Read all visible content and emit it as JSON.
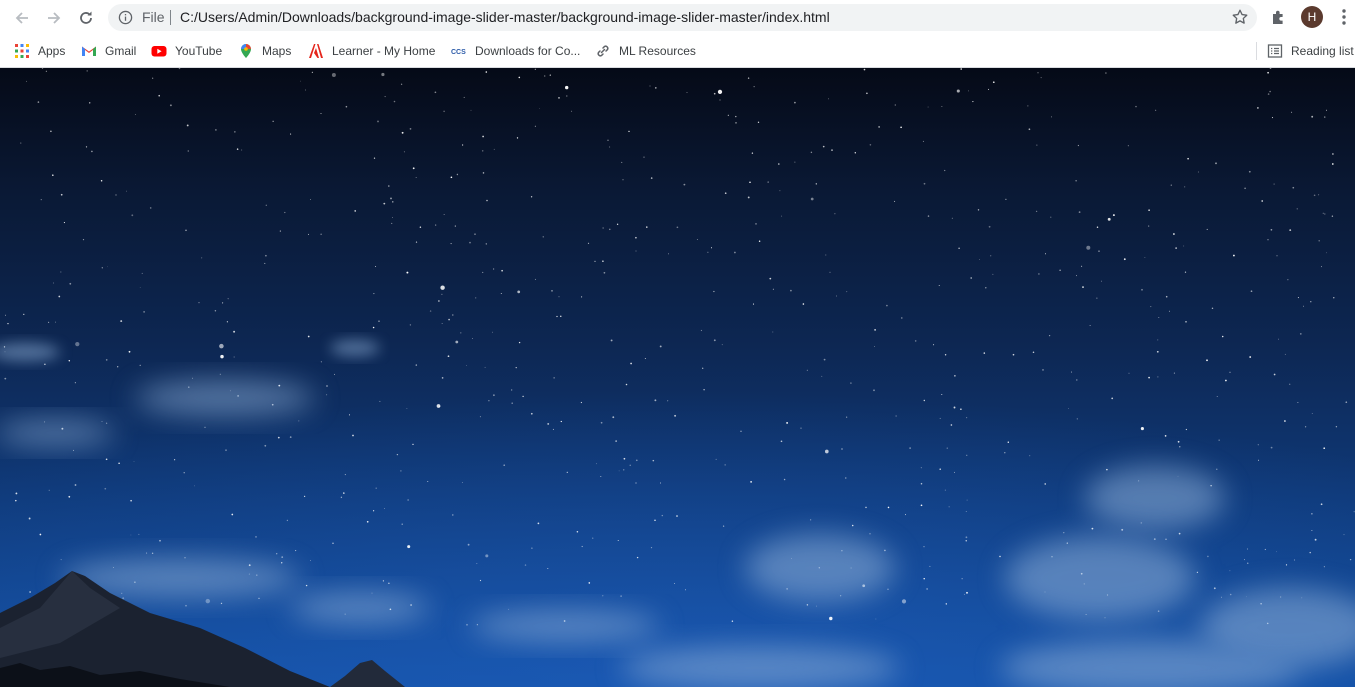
{
  "browser": {
    "nav": {
      "back_icon": "arrow-left-icon",
      "forward_icon": "arrow-right-icon",
      "reload_icon": "reload-icon"
    },
    "omnibox": {
      "scheme_label": "File",
      "url": "C:/Users/Admin/Downloads/background-image-slider-master/background-image-slider-master/index.html",
      "info_icon": "info-icon",
      "star_icon": "star-icon"
    },
    "extensions_icon": "puzzle-icon",
    "profile_initial": "H",
    "menu_icon": "kebab-menu-icon"
  },
  "bookmarks": {
    "items": [
      {
        "label": "Apps",
        "icon": "apps-grid-icon"
      },
      {
        "label": "Gmail",
        "icon": "gmail-icon"
      },
      {
        "label": "YouTube",
        "icon": "youtube-icon"
      },
      {
        "label": "Maps",
        "icon": "maps-pin-icon"
      },
      {
        "label": "Learner - My Home",
        "icon": "adobe-icon"
      },
      {
        "label": "Downloads for Co...",
        "icon": "ccs-icon"
      },
      {
        "label": "ML Resources",
        "icon": "link-icon"
      }
    ],
    "reading_list": {
      "label": "Reading list",
      "icon": "reading-list-icon"
    }
  },
  "page": {
    "background": "night-sky-stars-mountains-image",
    "colors": {
      "sky_top": "#050a17",
      "sky_bottom": "#1350a3"
    }
  }
}
